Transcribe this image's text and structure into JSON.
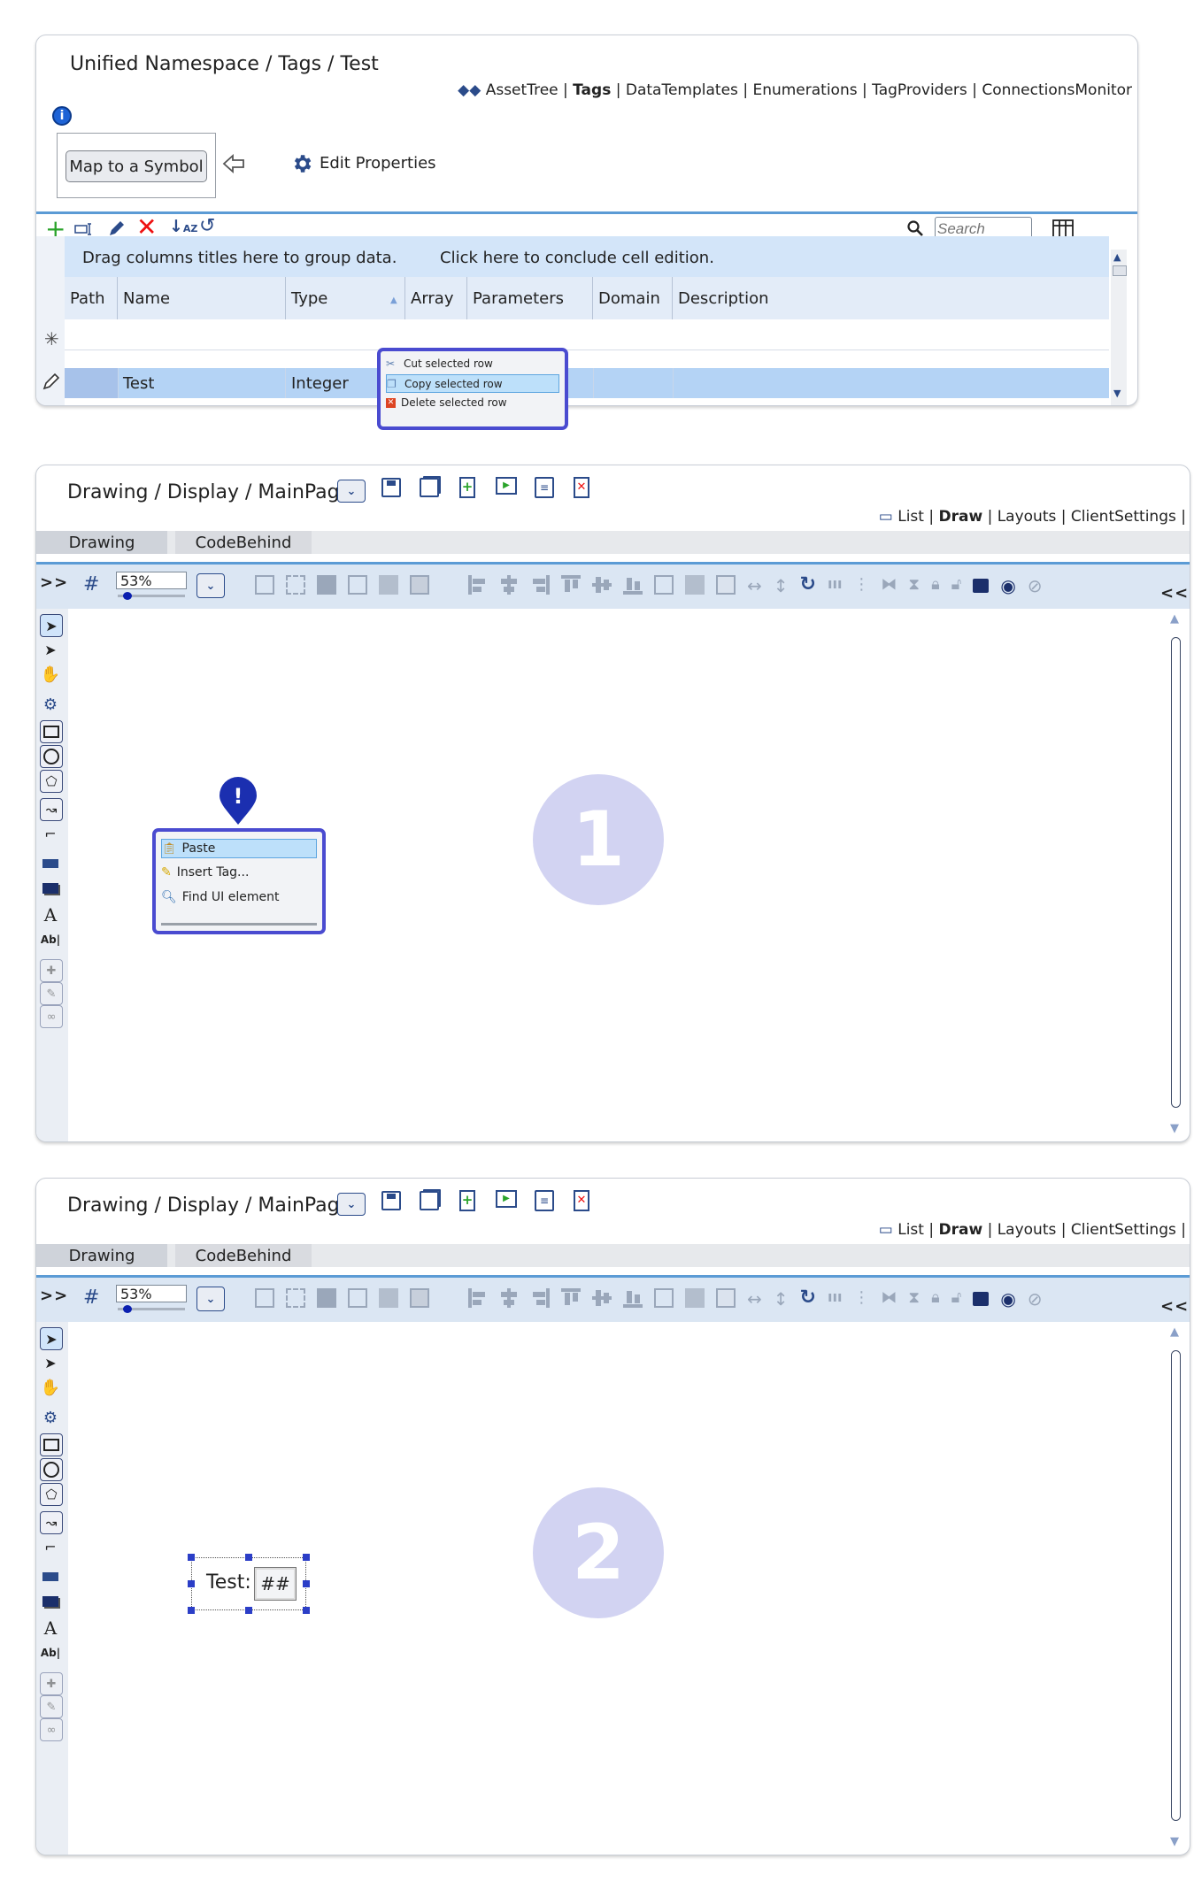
{
  "panel1": {
    "breadcrumb": "Unified Namespace / Tags / Test",
    "nav": {
      "asset_tree": "AssetTree",
      "tags": "Tags",
      "data_templates": "DataTemplates",
      "enumerations": "Enumerations",
      "tag_providers": "TagProviders",
      "connections_monitor": "ConnectionsMonitor"
    },
    "map_button": "Map to a Symbol",
    "edit_properties": "Edit Properties",
    "search_placeholder": "Search",
    "group_hint": "Drag columns titles here to group data.",
    "conclude_hint": "Click here to conclude cell edition.",
    "columns": [
      "Path",
      "Name",
      "Type",
      "Array",
      "Parameters",
      "Domain",
      "Description"
    ],
    "row": {
      "name": "Test",
      "type": "Integer"
    },
    "context_menu": [
      "Cut selected row",
      "Copy selected row",
      "Delete selected row"
    ],
    "context_menu_selected_index": 1
  },
  "drawing": {
    "breadcrumb": "Drawing / Display / MainPage",
    "nav": {
      "list": "List",
      "draw": "Draw",
      "layouts": "Layouts",
      "client_settings": "ClientSettings"
    },
    "tabs": [
      "Drawing",
      "CodeBehind"
    ],
    "expand": ">>",
    "collapse": "<<",
    "zoom": "53%"
  },
  "panel2": {
    "context_menu": [
      "Paste",
      "Insert Tag...",
      "Find UI element"
    ],
    "context_menu_selected_index": 0,
    "step": "1"
  },
  "panel3": {
    "label_text": "Test:",
    "value_text": "##",
    "step": "2"
  },
  "colors": {
    "accent_blue": "#5b9bd5",
    "menu_border": "#4a4bd0",
    "step_circle": "#d2d3f2",
    "toolbar": "#dbe6f3"
  }
}
